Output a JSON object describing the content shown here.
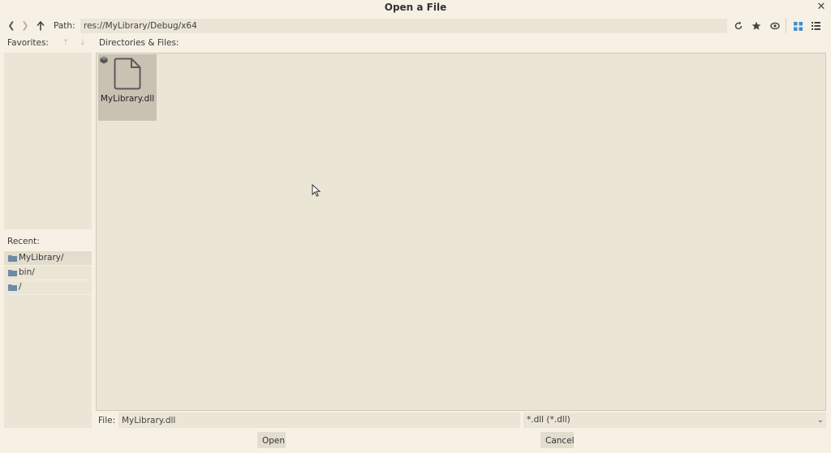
{
  "dialog": {
    "title": "Open a File",
    "close_icon": "close-icon"
  },
  "nav": {
    "back_icon": "chevron-left-icon",
    "forward_icon": "chevron-right-icon",
    "up_icon": "arrow-up-icon",
    "path_label": "Path:",
    "path_value": "res://MyLibrary/Debug/x64",
    "toolbar_icons": [
      "refresh-icon",
      "favorite-star-icon",
      "toggle-hidden-eye-icon",
      "grid-view-icon",
      "list-view-icon"
    ]
  },
  "favorites": {
    "label": "Favorites:",
    "items": []
  },
  "recent": {
    "label": "Recent:",
    "items": [
      {
        "label": "MyLibrary/"
      },
      {
        "label": "bin/"
      },
      {
        "label": "/"
      }
    ]
  },
  "files": {
    "label": "Directories & Files:",
    "items": [
      {
        "name": "MyLibrary.dll",
        "icon": "file-icon"
      }
    ]
  },
  "footer": {
    "file_label": "File:",
    "file_value": "MyLibrary.dll",
    "filter_value": "*.dll (*.dll)",
    "open_label": "Open",
    "cancel_label": "Cancel"
  },
  "colors": {
    "background": "#f6f1e4",
    "panel": "#ebe5d6",
    "selected_tile": "#c9c2b2",
    "accent_blue": "#3d8fd4"
  }
}
